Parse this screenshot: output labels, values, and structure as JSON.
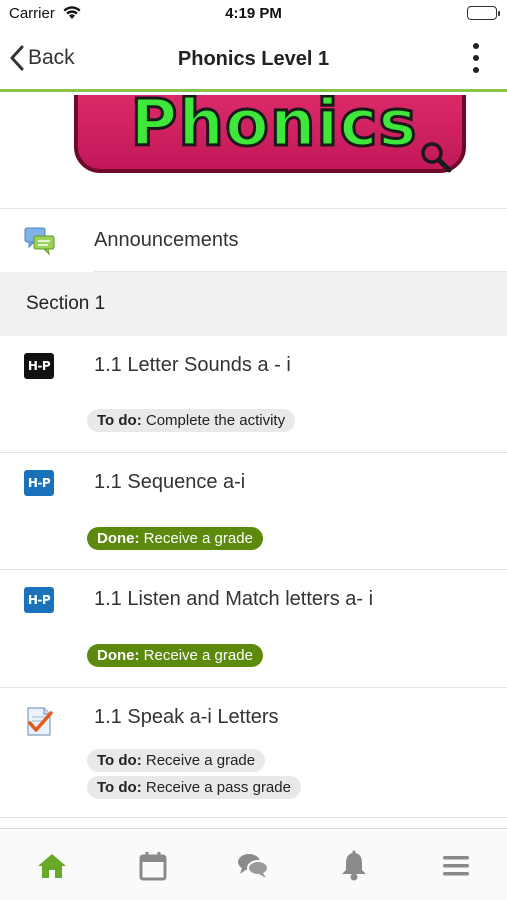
{
  "status_bar": {
    "carrier": "Carrier",
    "time": "4:19 PM",
    "battery_level": 1.0
  },
  "nav": {
    "back_label": "Back",
    "title": "Phonics Level 1",
    "back_icon": "chevron-left-icon",
    "more_icon": "more-vertical-icon"
  },
  "banner": {
    "text": "Phonics",
    "colors": {
      "text": "#3ee83a",
      "background": "#e4306c",
      "border": "#6d0a2b"
    }
  },
  "announcements": {
    "label": "Announcements",
    "icon": "forum-chat-icon"
  },
  "section": {
    "title": "Section 1"
  },
  "activities": [
    {
      "name": "1.1 Letter Sounds a - i",
      "icon_text": "H-P",
      "badges": [
        {
          "prefix": "To do:",
          "text": "Complete the activity",
          "status": "todo"
        }
      ]
    },
    {
      "name": "1.1 Sequence a-i",
      "icon_text": "H-P",
      "badges": [
        {
          "prefix": "Done:",
          "text": "Receive a grade",
          "status": "done"
        }
      ]
    },
    {
      "name": "1.1 Listen and Match letters a- i",
      "icon_text": "H-P",
      "badges": [
        {
          "prefix": "Done:",
          "text": "Receive a grade",
          "status": "done"
        }
      ]
    },
    {
      "name": "1.1 Speak a-i Letters",
      "icon": "assignment-check-icon",
      "badges": [
        {
          "prefix": "To do:",
          "text": "Receive a grade",
          "status": "todo"
        },
        {
          "prefix": "To do:",
          "text": "Receive a pass grade",
          "status": "todo"
        }
      ]
    }
  ],
  "tab_bar": {
    "items": [
      {
        "icon": "home-icon",
        "active": true
      },
      {
        "icon": "calendar-icon",
        "active": false
      },
      {
        "icon": "chat-bubbles-icon",
        "active": false
      },
      {
        "icon": "bell-icon",
        "active": false
      },
      {
        "icon": "menu-icon",
        "active": false
      }
    ],
    "colors": {
      "active": "#6aa82a",
      "inactive": "#8a8a8a"
    }
  }
}
